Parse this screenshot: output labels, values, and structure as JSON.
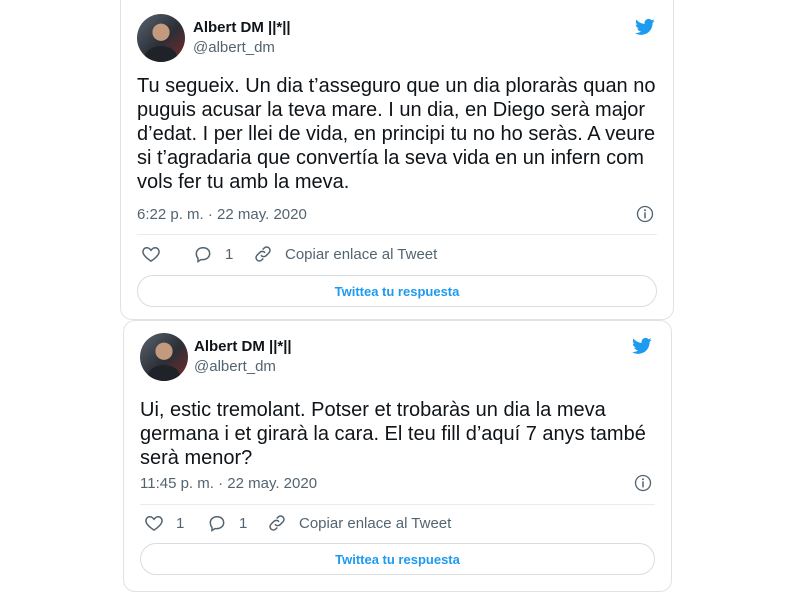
{
  "colors": {
    "accent": "#1d9bf0",
    "secondary_text": "#536471",
    "text": "#0f1419"
  },
  "tweets": [
    {
      "author": {
        "name": "Albert DM ||*||",
        "handle": "@albert_dm"
      },
      "text": "Tu segueix. Un dia t’asseguro que un dia ploraràs quan no puguis acusar la teva mare. I un dia, en Diego serà major d’edat. I per llei de vida, en principi tu no ho seràs. A veure si t’agradaria que convertía la seva vida en un infern com vols fer tu amb la meva.",
      "timestamp": "6:22 p. m. · 22 may. 2020",
      "likes": "",
      "replies": "1",
      "copy_link_label": "Copiar enlace al Tweet",
      "reply_button_label": "Twittea tu respuesta"
    },
    {
      "author": {
        "name": "Albert DM ||*||",
        "handle": "@albert_dm"
      },
      "text": "Ui, estic tremolant. Potser et trobaràs un dia la meva germana i et girarà la cara. El teu fill d’aquí 7 anys també serà menor?",
      "timestamp": "11:45 p. m. · 22 may. 2020",
      "likes": "1",
      "replies": "1",
      "copy_link_label": "Copiar enlace al Tweet",
      "reply_button_label": "Twittea tu respuesta"
    }
  ],
  "icons": {
    "brand": "twitter-bird-icon",
    "info": "info-icon",
    "like": "heart-icon",
    "reply": "comment-icon",
    "copy_link": "link-icon"
  }
}
